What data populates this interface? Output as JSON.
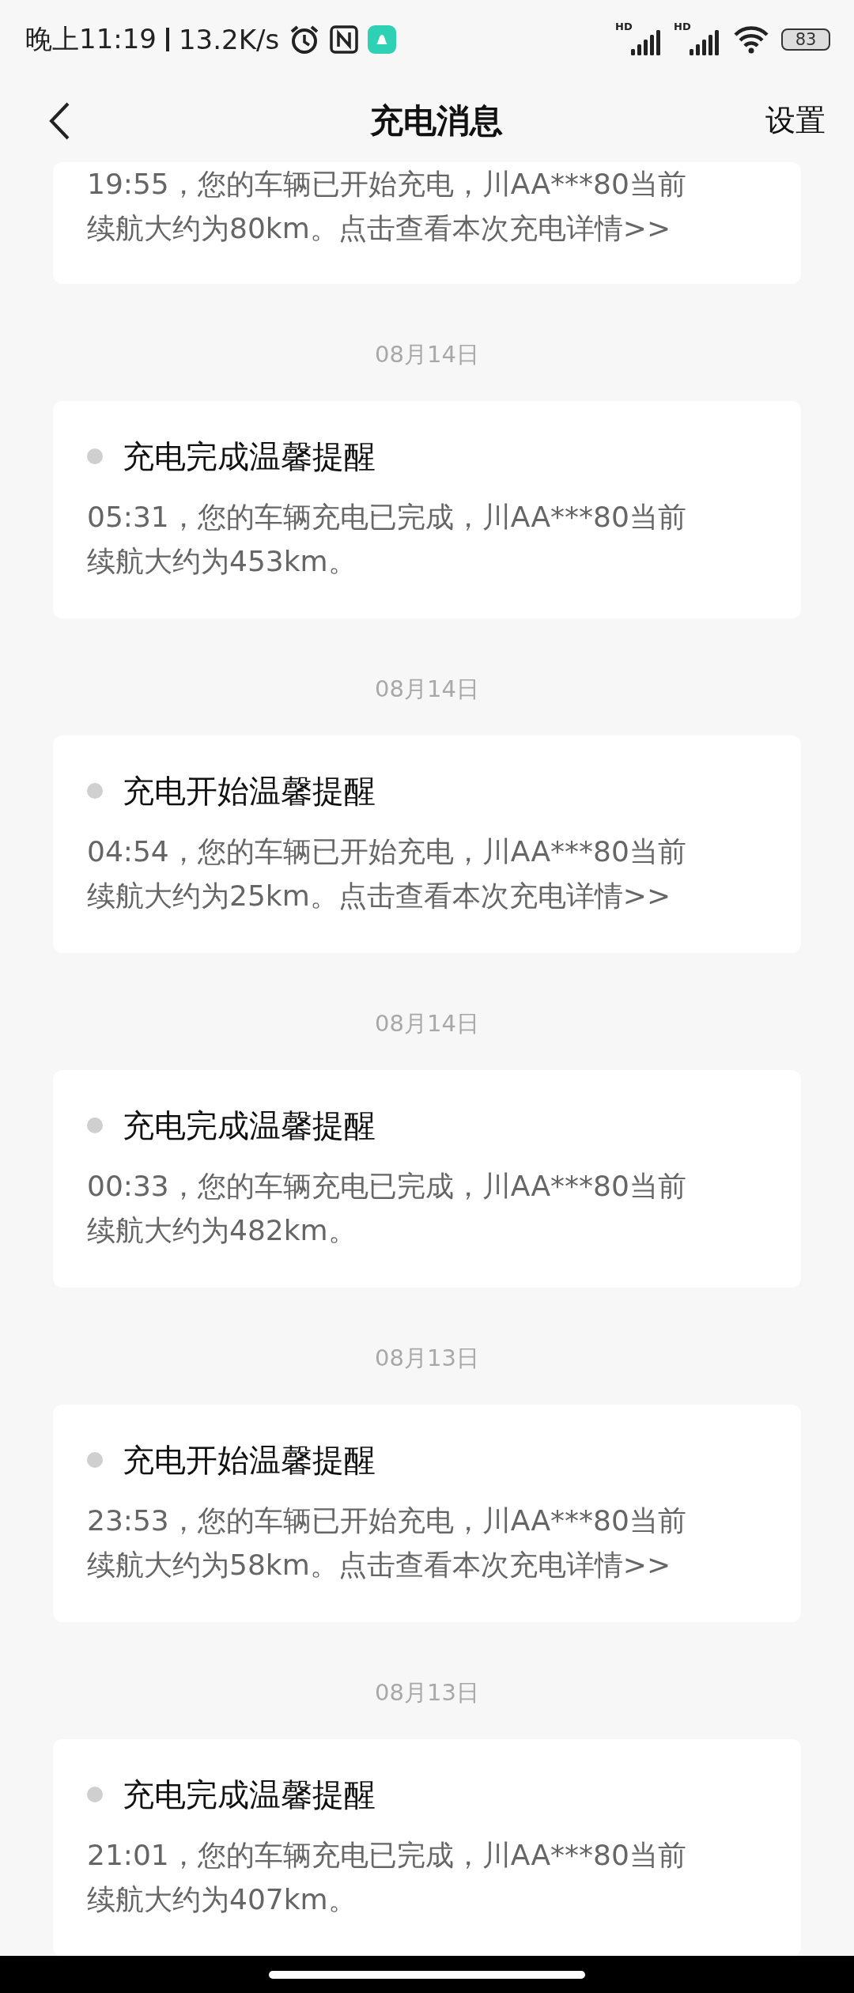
{
  "status_bar": {
    "time": "晚上11:19",
    "speed": "13.2K/s",
    "signals": [
      {
        "label": "HD"
      },
      {
        "label": "HD"
      }
    ],
    "battery": "83"
  },
  "header": {
    "title": "充电消息",
    "action": "设置"
  },
  "messages": [
    {
      "message": "19:55，您的车辆已开始充电，川AA***80当前续航大约为80km。点击查看本次充电详情>>"
    },
    {
      "date": "08月14日",
      "title": "充电完成温馨提醒",
      "message": "05:31，您的车辆充电已完成，川AA***80当前续航大约为453km。"
    },
    {
      "date": "08月14日",
      "title": "充电开始温馨提醒",
      "message": "04:54，您的车辆已开始充电，川AA***80当前续航大约为25km。点击查看本次充电详情>>"
    },
    {
      "date": "08月14日",
      "title": "充电完成温馨提醒",
      "message": "00:33，您的车辆充电已完成，川AA***80当前续航大约为482km。"
    },
    {
      "date": "08月13日",
      "title": "充电开始温馨提醒",
      "message": "23:53，您的车辆已开始充电，川AA***80当前续航大约为58km。点击查看本次充电详情>>"
    },
    {
      "date": "08月13日",
      "title": "充电完成温馨提醒",
      "message": "21:01，您的车辆充电已完成，川AA***80当前续航大约为407km。"
    }
  ]
}
